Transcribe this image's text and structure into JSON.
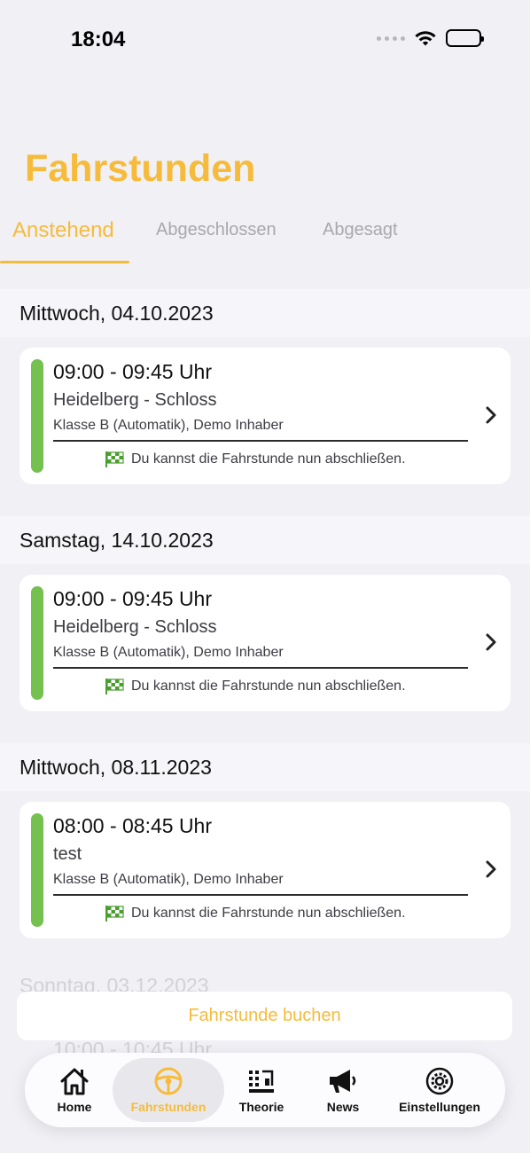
{
  "status_bar": {
    "time": "18:04"
  },
  "page": {
    "title": "Fahrstunden"
  },
  "tabs": [
    {
      "label": "Anstehend",
      "active": true
    },
    {
      "label": "Abgeschlossen",
      "active": false
    },
    {
      "label": "Abgesagt",
      "active": false
    }
  ],
  "lessons": [
    {
      "date": "Mittwoch, 04.10.2023",
      "time": "09:00 - 09:45 Uhr",
      "location": "Heidelberg - Schloss",
      "details": "Klasse B (Automatik), Demo Inhaber",
      "hint": "Du kannst die Fahrstunde nun abschließen."
    },
    {
      "date": "Samstag, 14.10.2023",
      "time": "09:00 - 09:45 Uhr",
      "location": "Heidelberg - Schloss",
      "details": "Klasse B (Automatik), Demo Inhaber",
      "hint": "Du kannst die Fahrstunde nun abschließen."
    },
    {
      "date": "Mittwoch, 08.11.2023",
      "time": "08:00 - 08:45 Uhr",
      "location": "test",
      "details": "Klasse B (Automatik), Demo Inhaber",
      "hint": "Du kannst die Fahrstunde nun abschließen."
    }
  ],
  "partial_lesson": {
    "date": "Sonntag, 03.12.2023",
    "time": "10:00 - 10:45 Uhr"
  },
  "book_button": {
    "label": "Fahrstunde buchen"
  },
  "tabbar": [
    {
      "label": "Home",
      "icon": "home-icon",
      "active": false
    },
    {
      "label": "Fahrstunden",
      "icon": "steering-wheel-icon",
      "active": true
    },
    {
      "label": "Theorie",
      "icon": "theory-icon",
      "active": false
    },
    {
      "label": "News",
      "icon": "megaphone-icon",
      "active": false
    },
    {
      "label": "Einstellungen",
      "icon": "gear-icon",
      "active": false
    }
  ],
  "colors": {
    "accent": "#f7bb3c",
    "status_green": "#75c14f",
    "background": "#f0f0f5"
  }
}
